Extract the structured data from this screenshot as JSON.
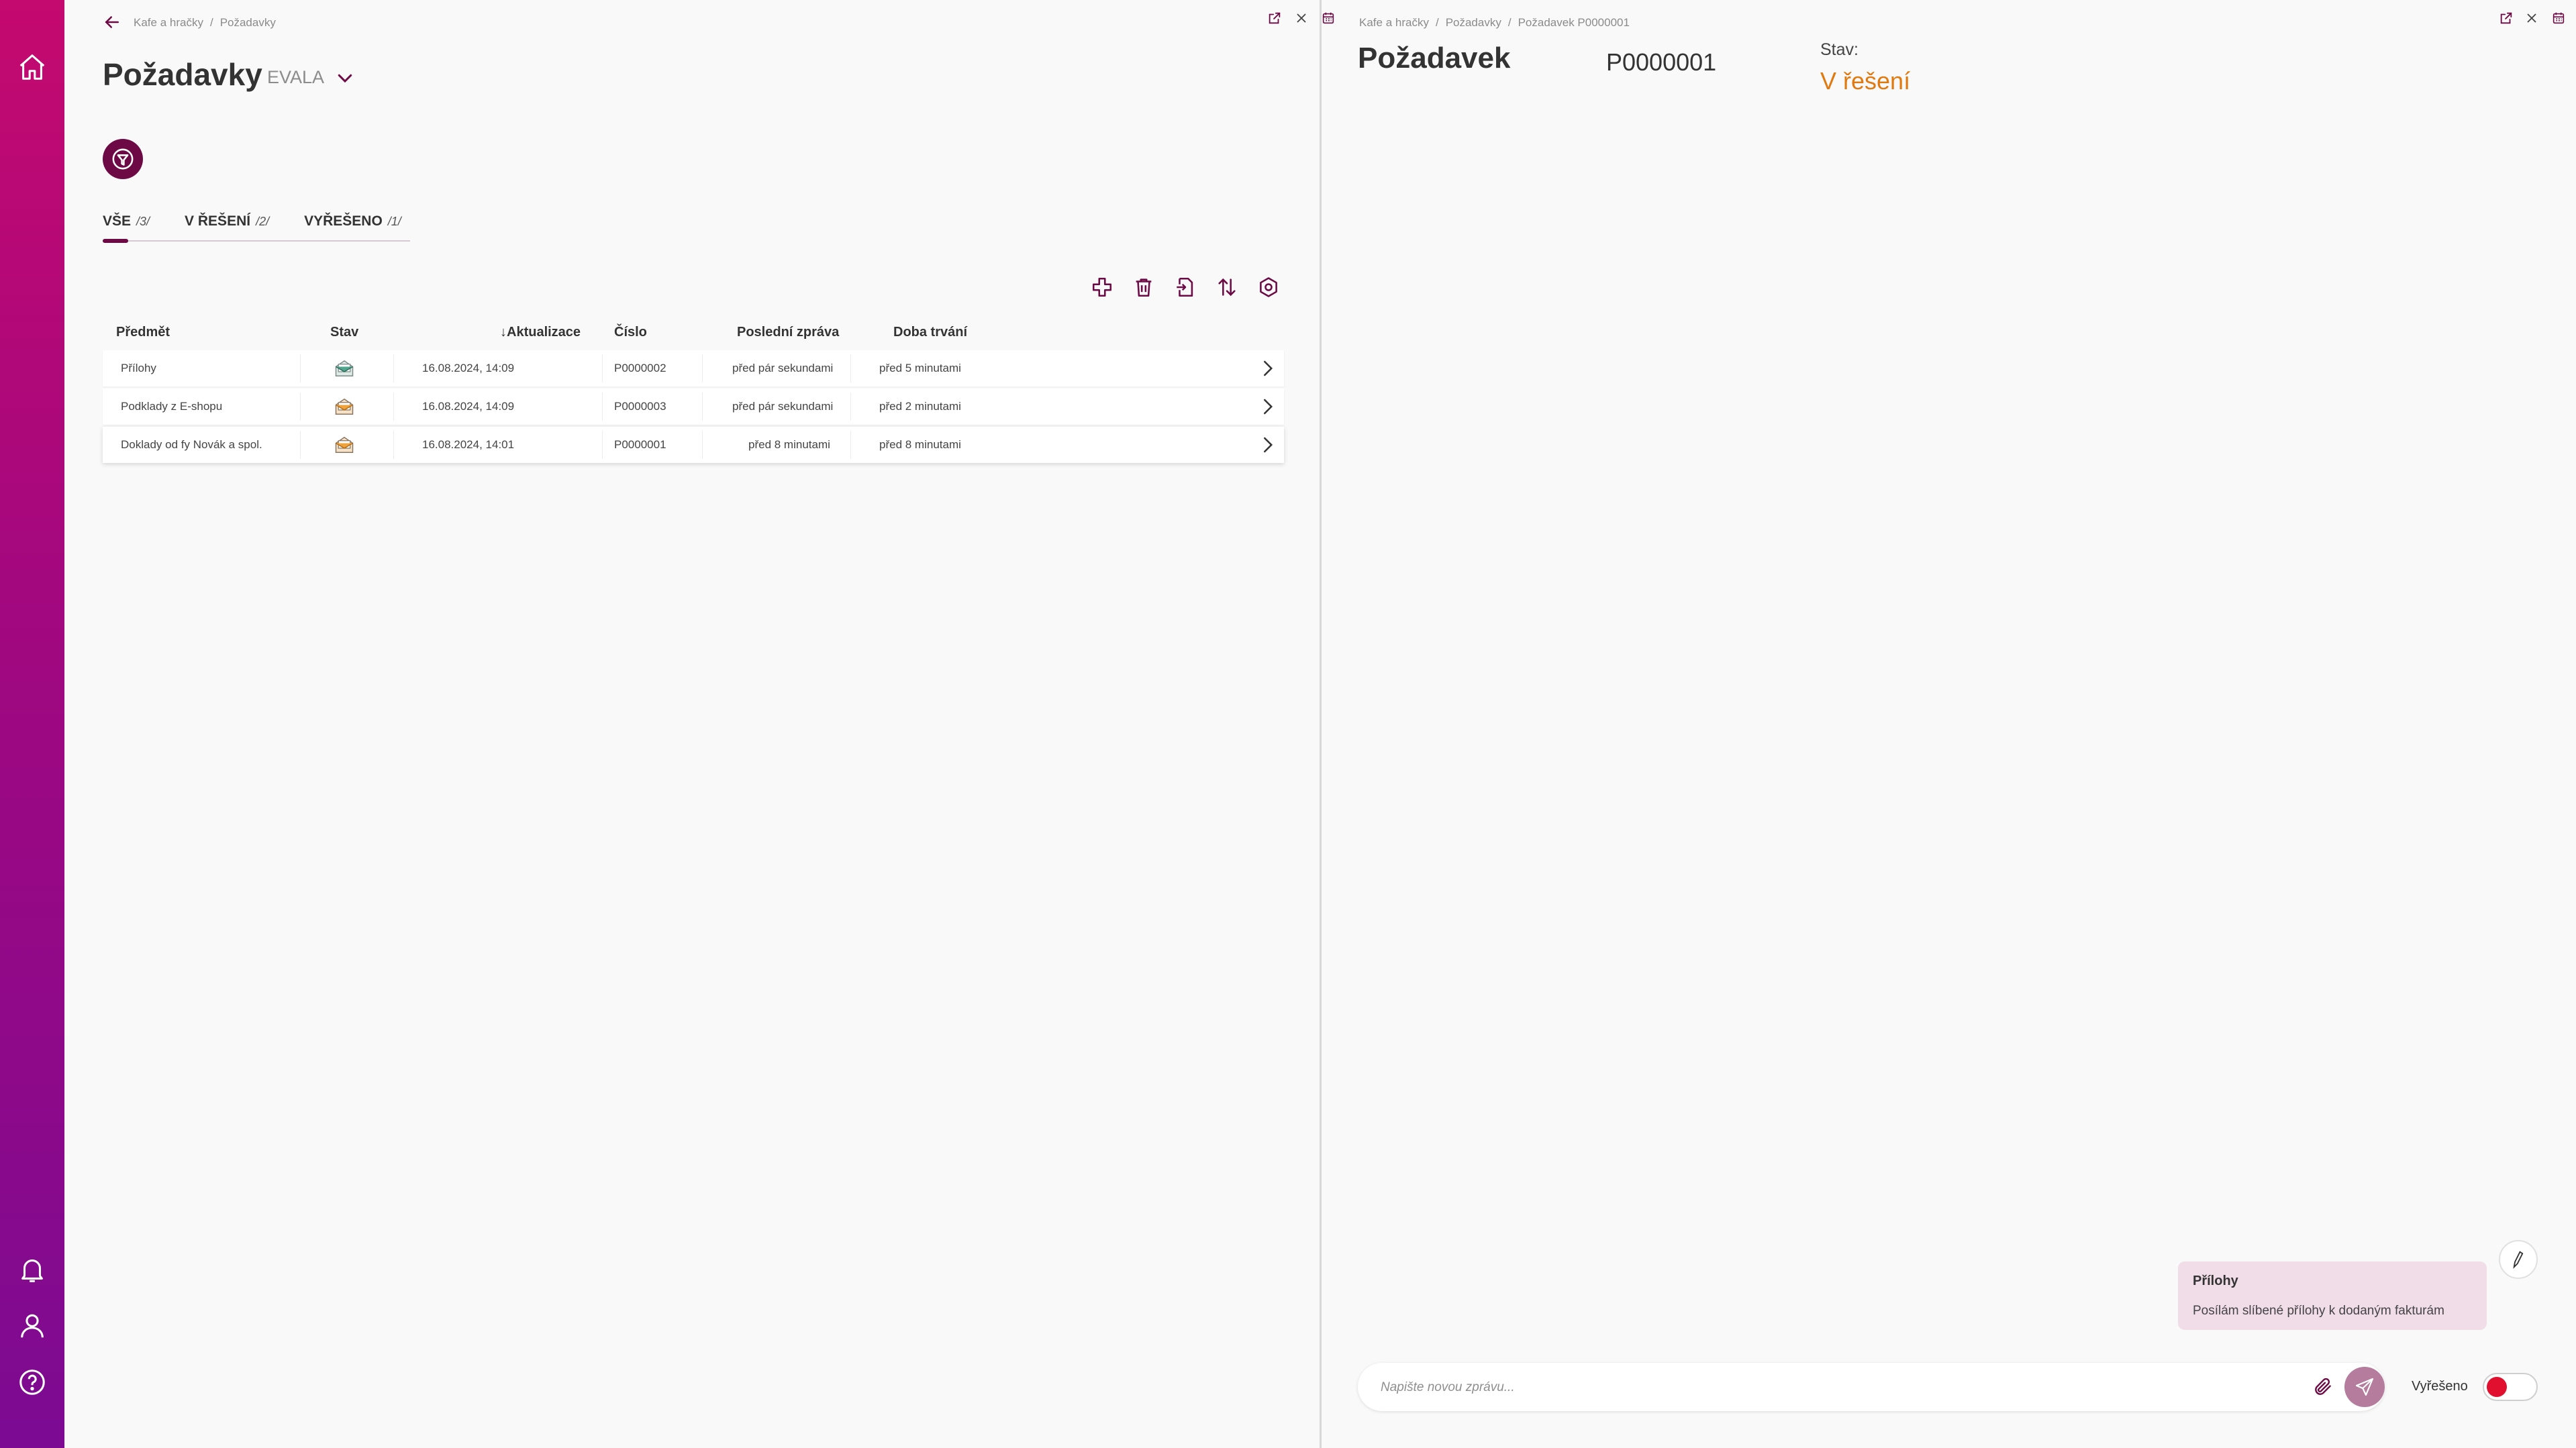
{
  "colors": {
    "brand": "#6d0a45",
    "status_orange": "#e07a10",
    "sidebar_top": "#c4096f",
    "sidebar_bottom": "#7c0a92"
  },
  "sidebar": {
    "icons": [
      "home-icon",
      "bell-icon",
      "user-icon",
      "help-icon"
    ]
  },
  "left": {
    "breadcrumb": [
      "Kafe a hračky",
      "Požadavky"
    ],
    "title": "Požadavky",
    "org": "EVALA",
    "tabs": [
      {
        "label": "VŠE",
        "count": "/3/",
        "active": true
      },
      {
        "label": "V ŘEŠENÍ",
        "count": "/2/",
        "active": false
      },
      {
        "label": "VYŘEŠENO",
        "count": "/1/",
        "active": false
      }
    ],
    "toolbar": [
      "add-icon",
      "delete-icon",
      "export-icon",
      "sort-icon",
      "settings-icon"
    ],
    "columns": {
      "subject": "Předmět",
      "status": "Stav",
      "updated": "Aktualizace",
      "number": "Číslo",
      "last_message": "Poslední zpráva",
      "duration": "Doba trvání"
    },
    "rows": [
      {
        "subject": "Přílohy",
        "updated": "16.08.2024, 14:09",
        "number": "P0000002",
        "last_message": "před pár sekundami",
        "duration": "před 5 minutami",
        "status_icon": "mail-read-icon"
      },
      {
        "subject": "Podklady z E-shopu",
        "updated": "16.08.2024, 14:09",
        "number": "P0000003",
        "last_message": "před pár sekundami",
        "duration": "před 2 minutami",
        "status_icon": "mail-open-icon"
      },
      {
        "subject": "Doklady od fy Novák a spol.",
        "updated": "16.08.2024, 14:01",
        "number": "P0000001",
        "last_message": "před 8 minutami",
        "duration": "před 8 minutami",
        "status_icon": "mail-open-icon"
      }
    ]
  },
  "right": {
    "breadcrumb": [
      "Kafe a hračky",
      "Požadavky",
      "Požadavek P0000001"
    ],
    "title": "Požadavek",
    "number": "P0000001",
    "status_label": "Stav:",
    "status_value": "V řešení",
    "message": {
      "title": "Přílohy",
      "text": "Posílám slíbené přílohy k dodaným fakturám"
    },
    "composer": {
      "placeholder": "Napište novou zprávu...",
      "value": ""
    },
    "resolved_label": "Vyřešeno",
    "resolved": false
  }
}
